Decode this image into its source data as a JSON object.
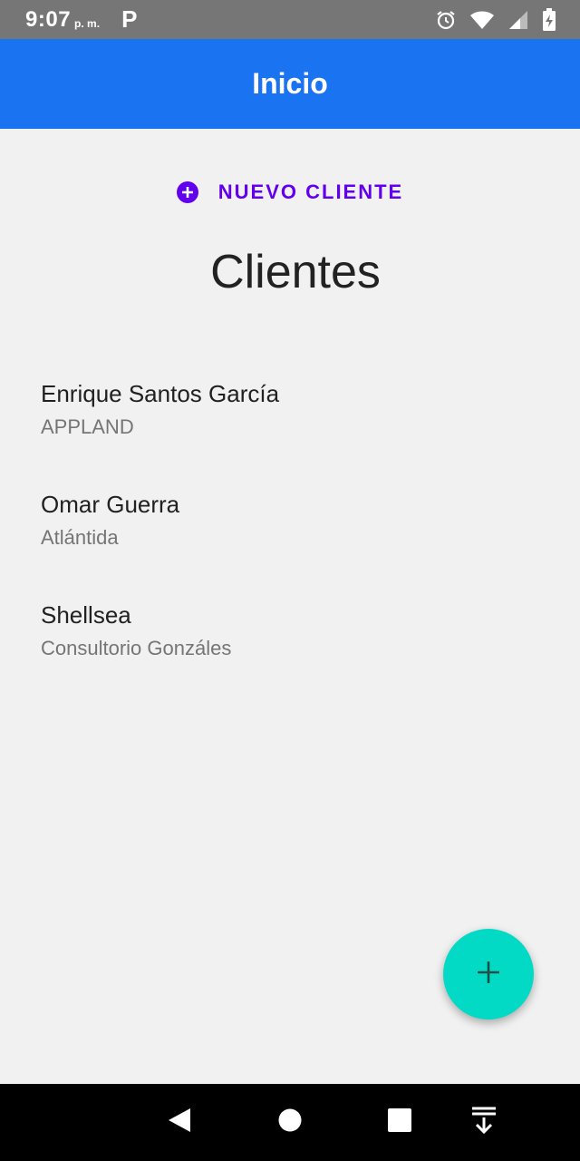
{
  "status_bar": {
    "time": "9:07",
    "ampm": "p. m.",
    "notification_glyph": "P",
    "icons": [
      "alarm-icon",
      "wifi-icon",
      "signal-icon",
      "battery-charging-icon"
    ]
  },
  "app_bar": {
    "title": "Inicio",
    "color": "#1a73f0"
  },
  "new_client_button": {
    "label": "NUEVO CLIENTE",
    "icon": "add-circle-icon",
    "color": "#6200ee"
  },
  "heading": "Clientes",
  "clients": [
    {
      "name": "Enrique Santos García",
      "company": "APPLAND"
    },
    {
      "name": "Omar Guerra",
      "company": "Atlántida"
    },
    {
      "name": "Shellsea",
      "company": "Consultorio Gonzáles"
    }
  ],
  "fab": {
    "icon": "plus-icon",
    "color": "#03dac5"
  },
  "nav_bar": {
    "buttons": [
      "back-icon",
      "home-icon",
      "recents-icon",
      "notifications-pull-icon"
    ]
  }
}
